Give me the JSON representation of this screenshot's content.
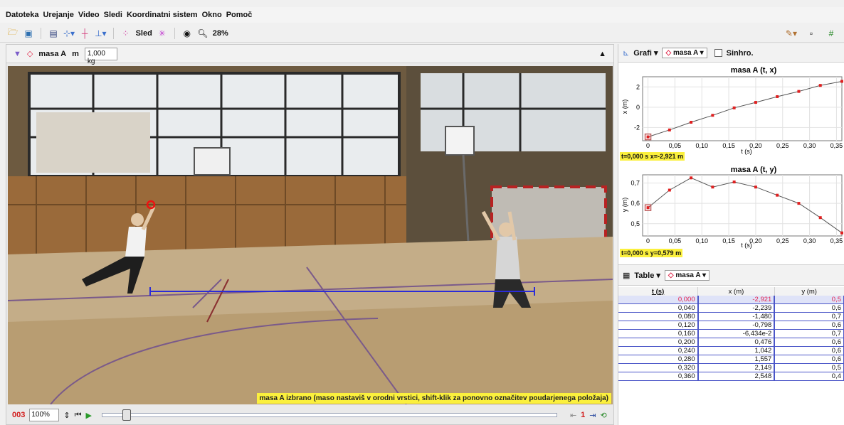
{
  "menu": [
    "Datoteka",
    "Urejanje",
    "Video",
    "Sledi",
    "Koordinatni sistem",
    "Okno",
    "Pomoč"
  ],
  "toolbar": {
    "track_label": "Sled",
    "zoom_label": "28%"
  },
  "video_panel": {
    "mass_label": "masa A",
    "m_label": "m",
    "mass_value": "1,000 kg",
    "status_message": "masa A izbrano (maso nastaviš v orodni vrstici, shift-klik za ponovno označitev poudarjenega položaja)",
    "frame_number": "003",
    "zoom_value": "100%",
    "step_count": "1"
  },
  "graphs": {
    "view_label": "Grafi",
    "track_label": "masa A",
    "sync_label": "Sinhro.",
    "x_plot": {
      "title": "masa A (t, x)",
      "ylabel": "x (m)",
      "xlabel": "t (s)",
      "readout": "t=0,000 s  x=-2,921 m",
      "yticks": [
        "2",
        "0",
        "-2"
      ]
    },
    "y_plot": {
      "title": "masa A (t, y)",
      "ylabel": "y (m)",
      "xlabel": "t (s)",
      "readout": "t=0,000 s  y=0,579 m",
      "yticks": [
        "0,7",
        "0,6",
        "0,5"
      ]
    },
    "xticks": [
      "0",
      "0,05",
      "0,10",
      "0,15",
      "0,20",
      "0,25",
      "0,30",
      "0,35"
    ]
  },
  "table": {
    "view_label": "Table",
    "track_label": "masa A",
    "headers": [
      "t (s)",
      "x (m)",
      "y (m)"
    ],
    "rows": [
      [
        "0,000",
        "-2,921",
        "0,5"
      ],
      [
        "0,040",
        "-2,239",
        "0,6"
      ],
      [
        "0,080",
        "-1,480",
        "0,7"
      ],
      [
        "0,120",
        "-0,798",
        "0,6"
      ],
      [
        "0,160",
        "-6,434e-2",
        "0,7"
      ],
      [
        "0,200",
        "0,476",
        "0,6"
      ],
      [
        "0,240",
        "1,042",
        "0,6"
      ],
      [
        "0,280",
        "1,557",
        "0,6"
      ],
      [
        "0,320",
        "2,149",
        "0,5"
      ],
      [
        "0,360",
        "2,548",
        "0,4"
      ]
    ]
  },
  "chart_data": [
    {
      "type": "scatter",
      "title": "masa A (t, x)",
      "xlabel": "t (s)",
      "ylabel": "x (m)",
      "x": [
        0.0,
        0.04,
        0.08,
        0.12,
        0.16,
        0.2,
        0.24,
        0.28,
        0.32,
        0.36
      ],
      "y": [
        -2.921,
        -2.239,
        -1.48,
        -0.798,
        -0.06434,
        0.476,
        1.042,
        1.557,
        2.149,
        2.548
      ],
      "xlim": [
        -0.01,
        0.36
      ],
      "ylim": [
        -3.3,
        3.0
      ]
    },
    {
      "type": "scatter",
      "title": "masa A (t, y)",
      "xlabel": "t (s)",
      "ylabel": "y (m)",
      "x": [
        0.0,
        0.04,
        0.08,
        0.12,
        0.16,
        0.2,
        0.24,
        0.28,
        0.32,
        0.36
      ],
      "y": [
        0.579,
        0.665,
        0.725,
        0.68,
        0.705,
        0.68,
        0.64,
        0.6,
        0.53,
        0.455
      ],
      "xlim": [
        -0.01,
        0.36
      ],
      "ylim": [
        0.44,
        0.74
      ]
    }
  ]
}
